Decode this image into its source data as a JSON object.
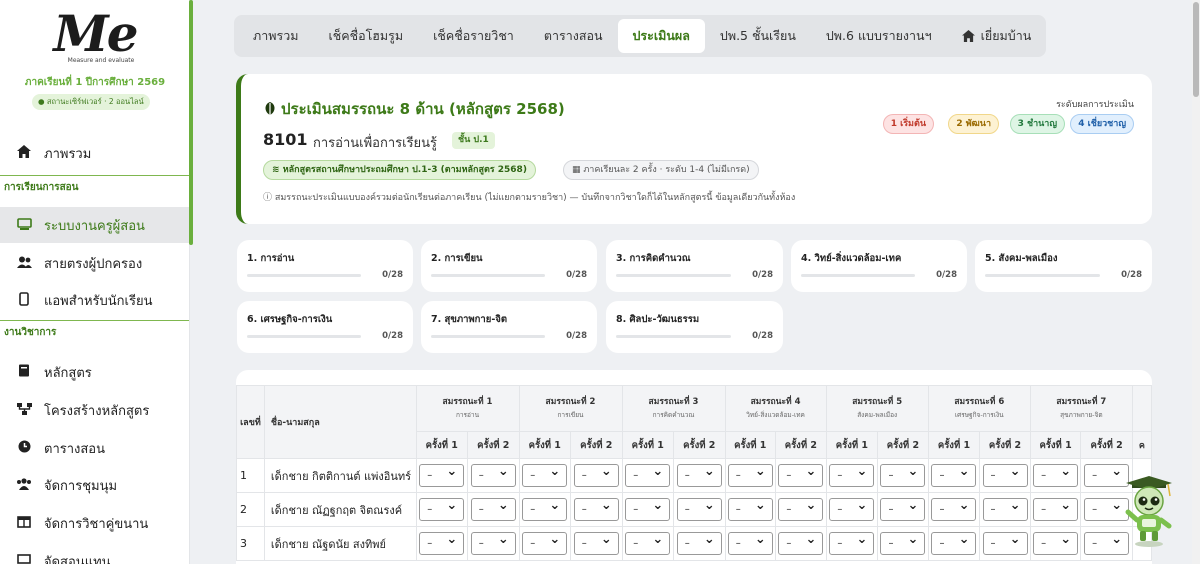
{
  "sidebar": {
    "logo_text": "Me",
    "logo_sub": "Measure and evaluate",
    "term": "ภาคเรียนที่ 1 ปีการศึกษา 2569",
    "status": "● สถานะเซิร์ฟเวอร์ · 2 ออนไลน์",
    "items": [
      {
        "label": "ภาพรวม",
        "icon": "home-icon"
      },
      {
        "label": "การเรียนการสอน"
      },
      {
        "label": "ระบบงานครูผู้สอน",
        "icon": "chalkboard-icon"
      },
      {
        "label": "สายตรงผู้ปกครอง",
        "icon": "users-icon"
      },
      {
        "label": "แอพสำหรับนักเรียน",
        "icon": "mobile-icon"
      },
      {
        "label": "งานวิชาการ"
      },
      {
        "label": "หลักสูตร",
        "icon": "book-icon"
      },
      {
        "label": "โครงสร้างหลักสูตร",
        "icon": "sitemap-icon"
      },
      {
        "label": "ตารางสอน",
        "icon": "clock-icon"
      },
      {
        "label": "จัดการชุมนุม",
        "icon": "group-icon"
      },
      {
        "label": "จัดการวิชาคู่ขนาน",
        "icon": "columns-icon"
      },
      {
        "label": "จัดสอนแทน",
        "icon": "swap-icon"
      }
    ]
  },
  "tabs": [
    "ภาพรวม",
    "เช็คชื่อโฮมรูม",
    "เช็คชื่อรายวิชา",
    "ตารางสอน",
    "ประเมินผล",
    "ปพ.5 ชั้นเรียน",
    "ปพ.6 แบบรายงานฯ",
    "เยี่ยมบ้าน"
  ],
  "header": {
    "title": "ประเมินสมรรถนะ 8 ด้าน (หลักสูตร 2568)",
    "course_code": "8101",
    "course_name": "การอ่านเพื่อการเรียนรู้",
    "grade": "ชั้น ป.1",
    "chip_curriculum": "หลักสูตรสถานศึกษาประถมศึกษา ป.1-3 (ตามหลักสูตร 2568)",
    "chip_terms": "ภาคเรียนละ 2 ครั้ง · ระดับ 1-4 (ไม่มีเกรด)",
    "note": "สมรรถนะประเมินแบบองค์รวมต่อนักเรียนต่อภาคเรียน (ไม่แยกตามรายวิชา) — บันทึกจากวิชาใดก็ได้ในหลักสูตรนี้ ข้อมูลเดียวกันทั้งห้อง",
    "levels_title": "ระดับผลการประเมิน",
    "levels": [
      {
        "label": "1 เริ่มต้น",
        "bg": "#fde3e3",
        "fg": "#c0392b",
        "border": "#f3b5b5"
      },
      {
        "label": "2 พัฒนา",
        "bg": "#fdf2d3",
        "fg": "#9a6a00",
        "border": "#f1d78a"
      },
      {
        "label": "3 ชำนาญ",
        "bg": "#def5e5",
        "fg": "#237a3e",
        "border": "#a7dfb8"
      },
      {
        "label": "4 เชี่ยวชาญ",
        "bg": "#e1effd",
        "fg": "#1f5fa8",
        "border": "#a9cdf2"
      }
    ]
  },
  "competencies": [
    {
      "title": "1. การอ่าน",
      "value": "0/28"
    },
    {
      "title": "2. การเขียน",
      "value": "0/28"
    },
    {
      "title": "3. การคิดคำนวณ",
      "value": "0/28"
    },
    {
      "title": "4. วิทย์-สิ่งแวดล้อม-เทค",
      "value": "0/28"
    },
    {
      "title": "5. สังคม-พลเมือง",
      "value": "0/28"
    },
    {
      "title": "6. เศรษฐกิจ-การเงิน",
      "value": "0/28"
    },
    {
      "title": "7. สุขภาพกาย-จิต",
      "value": "0/28"
    },
    {
      "title": "8. ศิลปะ-วัฒนธรรม",
      "value": "0/28"
    }
  ],
  "table": {
    "col_no": "เลขที่",
    "col_name": "ชื่อ-นามสกุล",
    "groups": [
      {
        "title": "สมรรถนะที่ 1",
        "sub": "การอ่าน"
      },
      {
        "title": "สมรรถนะที่ 2",
        "sub": "การเขียน"
      },
      {
        "title": "สมรรถนะที่ 3",
        "sub": "การคิดคำนวณ"
      },
      {
        "title": "สมรรถนะที่ 4",
        "sub": "วิทย์-สิ่งแวดล้อม-เทค"
      },
      {
        "title": "สมรรถนะที่ 5",
        "sub": "สังคม-พลเมือง"
      },
      {
        "title": "สมรรถนะที่ 6",
        "sub": "เศรษฐกิจ-การเงิน"
      },
      {
        "title": "สมรรถนะที่ 7",
        "sub": "สุขภาพกาย-จิต"
      }
    ],
    "time1": "ครั้งที่ 1",
    "time2": "ครั้งที่ 2",
    "select_value": "–",
    "rows": [
      {
        "no": "1",
        "name": "เด็กชาย กิตติกานต์ แพ่งอินทร์"
      },
      {
        "no": "2",
        "name": "เด็กชาย ณัฏฐกฤต จิตณรงค์"
      },
      {
        "no": "3",
        "name": "เด็กชาย ณัฐดนัย สงทิพย์"
      }
    ]
  }
}
